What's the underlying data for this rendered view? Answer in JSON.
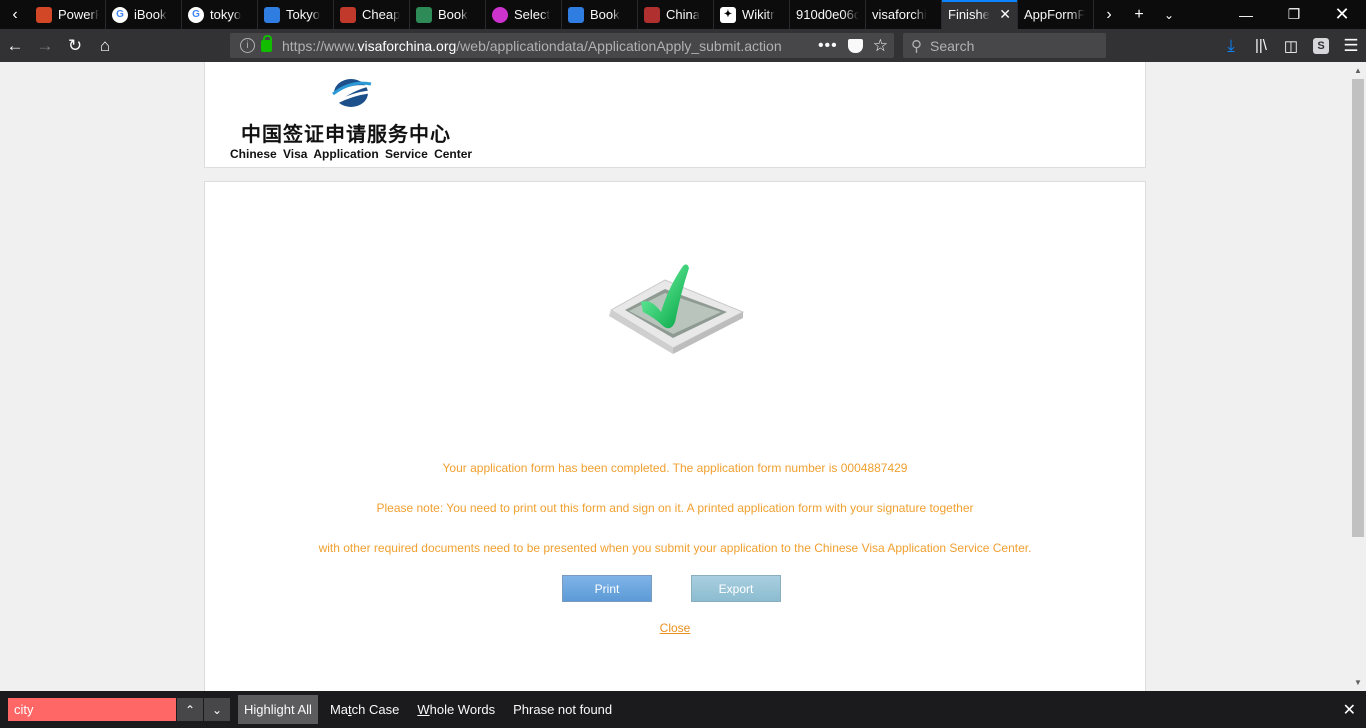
{
  "browser": {
    "tabs": [
      {
        "label": "PowerPoi",
        "icon": "powerpoint-icon",
        "color": "#d24726"
      },
      {
        "label": "iBook",
        "icon": "google-icon",
        "color": "#ffffff"
      },
      {
        "label": "tokyo",
        "icon": "google-icon",
        "color": "#ffffff"
      },
      {
        "label": "Tokyo",
        "icon": "bird-icon",
        "color": "#2f7de1"
      },
      {
        "label": "Cheap",
        "icon": "bag-icon",
        "color": "#c0392b"
      },
      {
        "label": "Book",
        "icon": "trip-icon",
        "color": "#2e8b57"
      },
      {
        "label": "Select",
        "icon": "circle-icon",
        "color": "#cc33cc"
      },
      {
        "label": "Book",
        "icon": "bird-icon",
        "color": "#2f7de1"
      },
      {
        "label": "China",
        "icon": "flag-icon",
        "color": "#b03030"
      },
      {
        "label": "Wikitr",
        "icon": "wikitravel-icon",
        "color": "#ffffff"
      },
      {
        "label": "910d0e06c",
        "icon": "",
        "color": ""
      },
      {
        "label": "visaforchi",
        "icon": "",
        "color": ""
      },
      {
        "label": "Finishe",
        "icon": "",
        "color": "",
        "active": true
      },
      {
        "label": "AppFormF",
        "icon": "",
        "color": ""
      }
    ],
    "url_prefix": "https://www.",
    "url_domain": "visaforchina.org",
    "url_path": "/web/applicationdata/ApplicationApply_submit.action",
    "search_placeholder": "Search"
  },
  "header": {
    "logo_cn": "中国签证申请服务中心",
    "logo_en": "Chinese Visa Application Service Center"
  },
  "main": {
    "message1": "Your application form has been completed. The application form number is 0004887429",
    "message2": "Please note: You need to print out this form and sign on it. A printed application form with your signature together",
    "message3": "with other required documents need to be presented when you submit your application to the Chinese Visa Application Service Center.",
    "print_label": "Print",
    "export_label": "Export",
    "close_label": "Close",
    "accent_color": "#f0a030"
  },
  "findbar": {
    "query": "city",
    "highlight_all": "Highlight All",
    "match_case_pre": "Ma",
    "match_case_u": "t",
    "match_case_post": "ch Case",
    "whole_words_pre": "",
    "whole_words_u": "W",
    "whole_words_post": "hole Words",
    "status": "Phrase not found"
  }
}
